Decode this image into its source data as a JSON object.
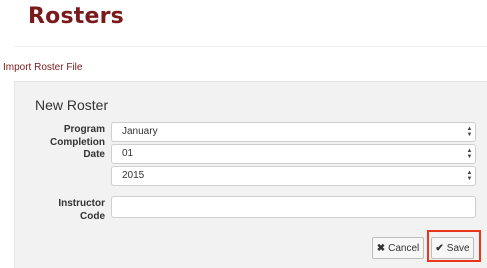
{
  "page": {
    "title": "Rosters"
  },
  "links": {
    "import_roster": "Import Roster File"
  },
  "form": {
    "title": "New Roster",
    "program_completion_label": "Program Completion Date",
    "month_value": "January",
    "day_value": "01",
    "year_value": "2015",
    "instructor_code_label": "Instructor Code",
    "instructor_code_value": ""
  },
  "buttons": {
    "cancel": "Cancel",
    "save": "Save"
  },
  "icons": {
    "cancel": "close-icon",
    "save": "checkmark-icon",
    "select": "select-arrows-icon"
  },
  "colors": {
    "brand": "#7a1a1a",
    "highlight": "#e8361b",
    "panel_bg": "#f2f2f2"
  }
}
